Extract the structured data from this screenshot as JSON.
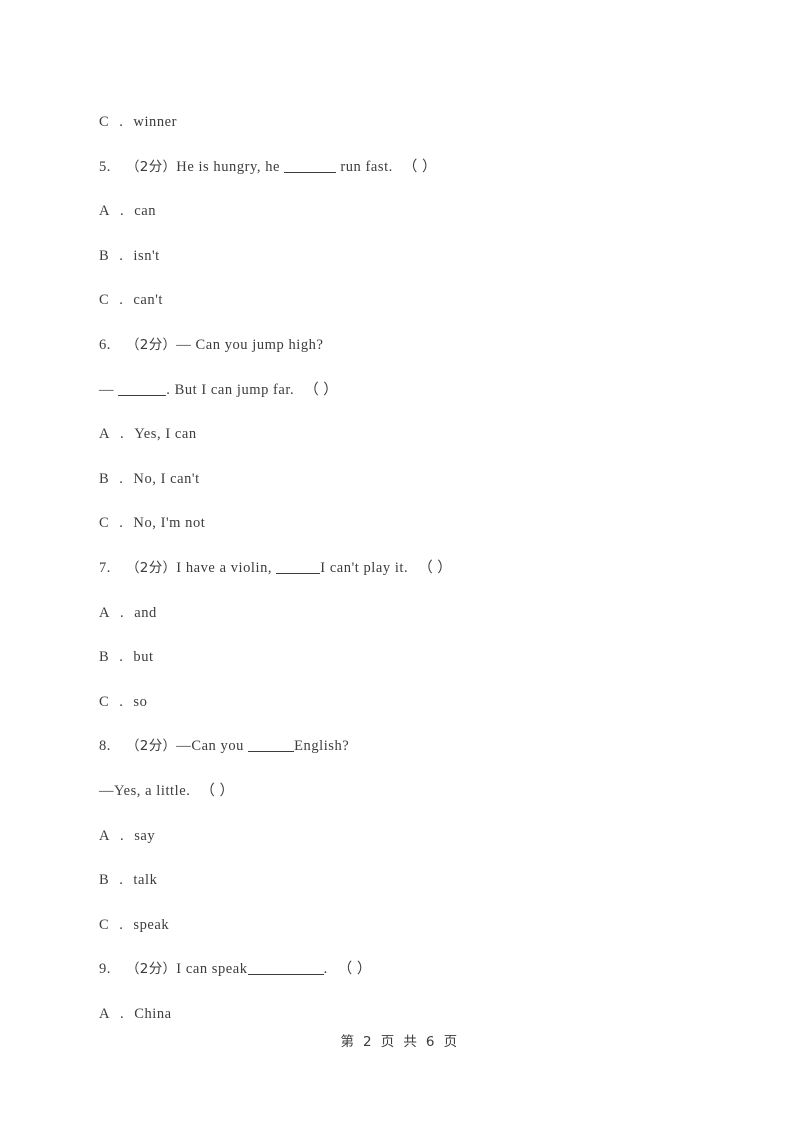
{
  "document": {
    "page_label": "第 2 页 共 6 页",
    "text_color": "#3c3c3c",
    "background_color": "#ffffff"
  },
  "lines": [
    {
      "kind": "option",
      "letter": "C",
      "sep": ".",
      "text": "winner"
    },
    {
      "kind": "question",
      "number": "5.",
      "score": "（2分）",
      "pre": "He is hungry, he",
      "blank": true,
      "post": "run fast.",
      "answer_box": "（     ）"
    },
    {
      "kind": "option",
      "letter": "A",
      "sep": ".",
      "text": "can"
    },
    {
      "kind": "option",
      "letter": "B",
      "sep": ".",
      "text": "isn't"
    },
    {
      "kind": "option",
      "letter": "C",
      "sep": ".",
      "text": "can't"
    },
    {
      "kind": "question",
      "number": "6.",
      "score": "（2分）",
      "pre": "— Can you jump high?",
      "blank": false,
      "post": "",
      "answer_box": ""
    },
    {
      "kind": "continuation",
      "pre": "—",
      "blank": true,
      "post": ". But I can jump far.",
      "answer_box": "（     ）"
    },
    {
      "kind": "option",
      "letter": "A",
      "sep": ".",
      "text": "Yes, I can"
    },
    {
      "kind": "option",
      "letter": "B",
      "sep": ".",
      "text": "No, I can't"
    },
    {
      "kind": "option",
      "letter": "C",
      "sep": ".",
      "text": "No, I'm not"
    },
    {
      "kind": "question",
      "number": "7.",
      "score": "（2分）",
      "pre": "I have a violin,",
      "blank": true,
      "post": "I can't play it.",
      "answer_box": "（     ）"
    },
    {
      "kind": "option",
      "letter": "A",
      "sep": ".",
      "text": "and"
    },
    {
      "kind": "option",
      "letter": "B",
      "sep": ".",
      "text": "but"
    },
    {
      "kind": "option",
      "letter": "C",
      "sep": ".",
      "text": "so"
    },
    {
      "kind": "question",
      "number": "8.",
      "score": "（2分）",
      "pre": "—Can you",
      "blank": true,
      "post": "English?",
      "answer_box": ""
    },
    {
      "kind": "continuation",
      "pre": "—Yes, a little.",
      "blank": false,
      "post": "",
      "answer_box": "（     ）"
    },
    {
      "kind": "option",
      "letter": "A",
      "sep": ".",
      "text": "say"
    },
    {
      "kind": "option",
      "letter": "B",
      "sep": ".",
      "text": "talk"
    },
    {
      "kind": "option",
      "letter": "C",
      "sep": ".",
      "text": "speak"
    },
    {
      "kind": "question",
      "number": "9.",
      "score": "（2分）",
      "pre": "I can speak",
      "blank": true,
      "post": ".",
      "answer_box": "（     ）"
    },
    {
      "kind": "option",
      "letter": "A",
      "sep": ".",
      "text": "China"
    }
  ]
}
